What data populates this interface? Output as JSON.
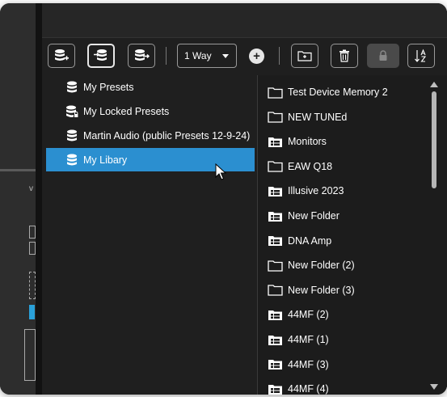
{
  "toolbar": {
    "sync_mode": "1 Way",
    "buttons": [
      {
        "name": "add-database-button",
        "icon": "database-plus-icon"
      },
      {
        "name": "import-database-button",
        "icon": "database-import-icon"
      },
      {
        "name": "export-database-button",
        "icon": "database-export-icon"
      },
      {
        "name": "add-button",
        "icon": "plus-circle-icon"
      },
      {
        "name": "new-folder-button",
        "icon": "folder-plus-icon"
      },
      {
        "name": "delete-button",
        "icon": "trash-icon"
      },
      {
        "name": "lock-button",
        "icon": "lock-icon"
      },
      {
        "name": "sort-button",
        "icon": "sort-az-icon"
      }
    ]
  },
  "presets": [
    {
      "label": "My Presets",
      "icon": "database-icon",
      "selected": false
    },
    {
      "label": "My Locked Presets",
      "icon": "database-lock-icon",
      "selected": false
    },
    {
      "label": "Martin Audio (public Presets 12-9-24)",
      "icon": "database-icon",
      "selected": false
    },
    {
      "label": "My Libary",
      "icon": "database-icon",
      "selected": true
    }
  ],
  "folders": [
    {
      "label": "Test Device Memory 2",
      "icon": "folder-empty-icon"
    },
    {
      "label": "NEW TUNEd",
      "icon": "folder-empty-icon"
    },
    {
      "label": "Monitors",
      "icon": "folder-content-icon"
    },
    {
      "label": "EAW Q18",
      "icon": "folder-empty-icon"
    },
    {
      "label": "Illusive 2023",
      "icon": "folder-content-icon"
    },
    {
      "label": "New Folder",
      "icon": "folder-content-icon"
    },
    {
      "label": "DNA Amp",
      "icon": "folder-content-icon"
    },
    {
      "label": "New Folder (2)",
      "icon": "folder-empty-icon"
    },
    {
      "label": "New Folder (3)",
      "icon": "folder-empty-icon"
    },
    {
      "label": "44MF (2)",
      "icon": "folder-content-icon"
    },
    {
      "label": "44MF (1)",
      "icon": "folder-content-icon"
    },
    {
      "label": "44MF (3)",
      "icon": "folder-content-icon"
    },
    {
      "label": "44MF (4)",
      "icon": "folder-content-icon"
    }
  ],
  "colors": {
    "accent": "#2b8fd0",
    "background": "#1f1f1f"
  }
}
